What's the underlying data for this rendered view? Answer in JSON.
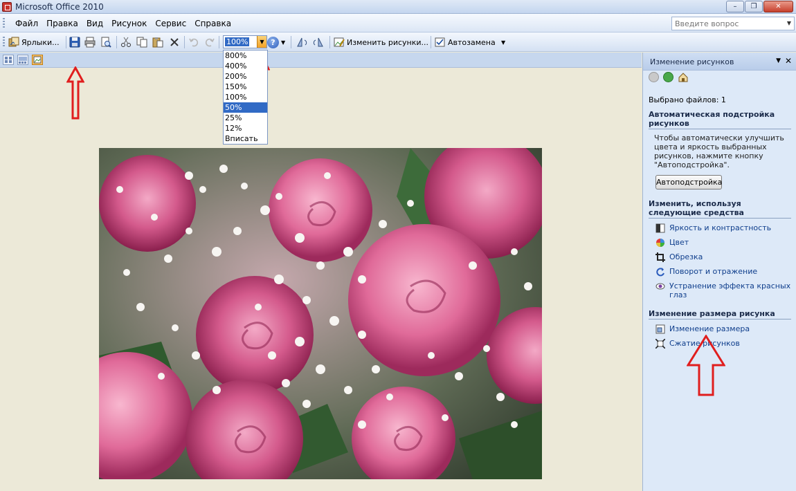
{
  "window": {
    "title": "Microsoft Office 2010"
  },
  "menu": [
    {
      "key": "file",
      "label": "Файл"
    },
    {
      "key": "edit",
      "label": "Правка"
    },
    {
      "key": "view",
      "label": "Вид"
    },
    {
      "key": "picture",
      "label": "Рисунок"
    },
    {
      "key": "service",
      "label": "Сервис"
    },
    {
      "key": "help",
      "label": "Справка"
    }
  ],
  "question": {
    "placeholder": "Введите вопрос"
  },
  "toolbar": {
    "shortcuts_label": "Ярлыки...",
    "zoom_value": "100%",
    "edit_pictures_label": "Изменить рисунки...",
    "autocorrect_label": "Автозамена"
  },
  "zoom_options": [
    "800%",
    "400%",
    "200%",
    "150%",
    "100%",
    "50%",
    "25%",
    "12%",
    "Вписать"
  ],
  "zoom_selected": "50%",
  "pane": {
    "title": "Изменение рисунков",
    "files_selected": "Выбрано файлов: 1",
    "auto_section": "Автоматическая подстройка рисунков",
    "auto_note": "Чтобы автоматически улучшить цвета и яркость выбранных рисунков, нажмите кнопку \"Автоподстройка\".",
    "auto_button": "Автоподстройка",
    "tools_section": "Изменить, используя следующие средства",
    "tools": [
      {
        "label": "Яркость и контрастность",
        "icon": "brightness-contrast-icon"
      },
      {
        "label": "Цвет",
        "icon": "color-icon"
      },
      {
        "label": "Обрезка",
        "icon": "crop-icon"
      },
      {
        "label": "Поворот и отражение",
        "icon": "rotate-flip-icon"
      },
      {
        "label": "Устранение эффекта красных глаз",
        "icon": "red-eye-icon"
      }
    ],
    "resize_section": "Изменение размера рисунка",
    "resize_links": [
      {
        "label": "Изменение размера",
        "icon": "resize-icon"
      },
      {
        "label": "Сжатие рисунков",
        "icon": "compress-icon"
      }
    ]
  },
  "colors": {
    "accent": "#316ac5",
    "annotation": "#e01e1e"
  }
}
